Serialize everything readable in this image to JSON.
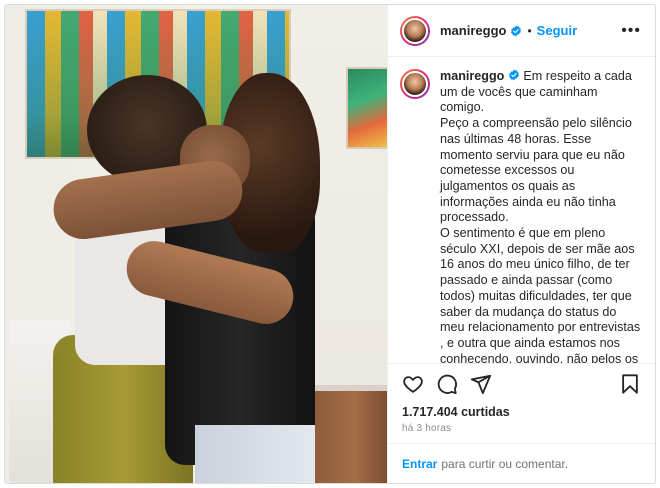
{
  "header": {
    "username": "manireggo",
    "separator": "•",
    "follow_label": "Seguir",
    "more_icon": "more-options-icon"
  },
  "caption": {
    "username": "manireggo",
    "text": "Em respeito a cada um de vocês que caminham comigo.\nPeço a compreensão pelo silêncio nas últimas 48 horas. Esse momento serviu para que eu não cometesse excessos ou julgamentos os quais as informações ainda eu não tinha processado.\nO sentimento é que em pleno século XXI, depois de ser mãe aos 16 anos do meu único filho, de ter passado e ainda passar (como todos) muitas dificuldades, ter que saber da mudança do status do meu relacionamento por entrevistas , e outra que ainda estamos nos conhecendo, ouvindo, não pelos os comentários de internet, mas as palavras que saíram em rede nacional vindas de uma pessoa que conviveu já a tempo suficiente para"
  },
  "actions": {
    "like_icon": "heart-icon",
    "comment_icon": "comment-icon",
    "share_icon": "share-icon",
    "save_icon": "bookmark-icon"
  },
  "likes_text": "1.717.404 curtidas",
  "time_text": "há 3 horas",
  "login": {
    "link_label": "Entrar",
    "text": "para curtir ou comentar."
  },
  "colors": {
    "accent": "#0095f6",
    "verified": "#0095f6",
    "text": "#262626",
    "muted": "#8e8e8e"
  }
}
